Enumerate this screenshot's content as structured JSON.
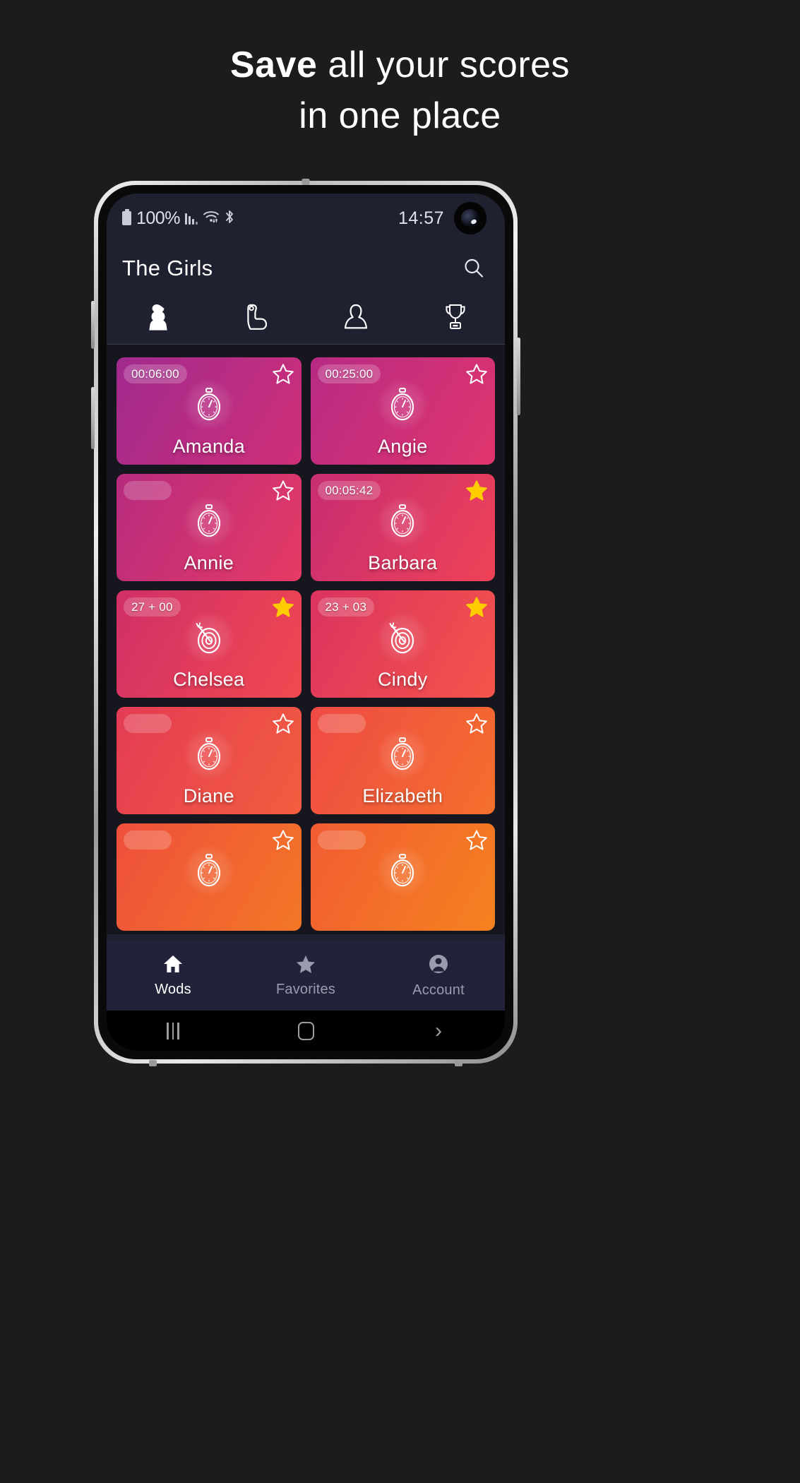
{
  "promo": {
    "line1_strong": "Save",
    "line1_rest": " all your scores",
    "line2": "in one place"
  },
  "status_bar": {
    "battery": "100%",
    "clock": "14:57",
    "icons": [
      "battery-icon",
      "signal-bars-icon",
      "wifi-icon",
      "bluetooth-icon",
      "front-camera"
    ]
  },
  "appbar": {
    "title": "The Girls",
    "search_icon": "search-icon"
  },
  "tabs": [
    {
      "icon": "chess-pawn-icon",
      "active": true
    },
    {
      "icon": "bicep-muscle-icon",
      "active": false
    },
    {
      "icon": "person-bust-icon",
      "active": false
    },
    {
      "icon": "trophy-icon",
      "active": false
    }
  ],
  "cards": [
    {
      "name": "Amanda",
      "badge": "00:06:00",
      "icon": "stopwatch-icon",
      "favorite": false,
      "grad_from": "#a12a8e",
      "grad_to": "#cf2f78"
    },
    {
      "name": "Angie",
      "badge": "00:25:00",
      "icon": "stopwatch-icon",
      "favorite": false,
      "grad_from": "#b72a84",
      "grad_to": "#e0356d"
    },
    {
      "name": "Annie",
      "badge": "",
      "icon": "stopwatch-icon",
      "favorite": false,
      "grad_from": "#b62b7f",
      "grad_to": "#e63a64"
    },
    {
      "name": "Barbara",
      "badge": "00:05:42",
      "icon": "stopwatch-icon",
      "favorite": true,
      "grad_from": "#c72d72",
      "grad_to": "#ef4257"
    },
    {
      "name": "Chelsea",
      "badge": "27 + 00",
      "icon": "target-icon",
      "favorite": true,
      "grad_from": "#d02f68",
      "grad_to": "#f2494f"
    },
    {
      "name": "Cindy",
      "badge": "23 + 03",
      "icon": "target-icon",
      "favorite": true,
      "grad_from": "#da3360",
      "grad_to": "#f4554a"
    },
    {
      "name": "Diane",
      "badge": "",
      "icon": "stopwatch-icon",
      "favorite": false,
      "grad_from": "#e33b55",
      "grad_to": "#f45d3e"
    },
    {
      "name": "Elizabeth",
      "badge": "",
      "icon": "stopwatch-icon",
      "favorite": false,
      "grad_from": "#ef4a45",
      "grad_to": "#f4702c"
    },
    {
      "name": "",
      "badge": "",
      "icon": "stopwatch-icon",
      "favorite": false,
      "grad_from": "#ef4f3c",
      "grad_to": "#f37726"
    },
    {
      "name": "",
      "badge": "",
      "icon": "stopwatch-icon",
      "favorite": false,
      "grad_from": "#f25c33",
      "grad_to": "#f4821f"
    }
  ],
  "bottom_nav": [
    {
      "label": "Wods",
      "icon": "home-icon",
      "active": true
    },
    {
      "label": "Favorites",
      "icon": "star-icon",
      "active": false
    },
    {
      "label": "Account",
      "icon": "person-circle-icon",
      "active": false
    }
  ],
  "system_nav": [
    {
      "icon": "recents-icon"
    },
    {
      "icon": "home-square-icon"
    },
    {
      "icon": "back-chevron-icon"
    }
  ],
  "colors": {
    "page_background": "#1c1c1c",
    "app_background": "#16161f",
    "chrome": "#1f2030",
    "bottom_nav": "#22233a",
    "favorite_star": "#ffcc00",
    "text_primary": "#ffffff",
    "text_muted": "#9a9cad"
  }
}
